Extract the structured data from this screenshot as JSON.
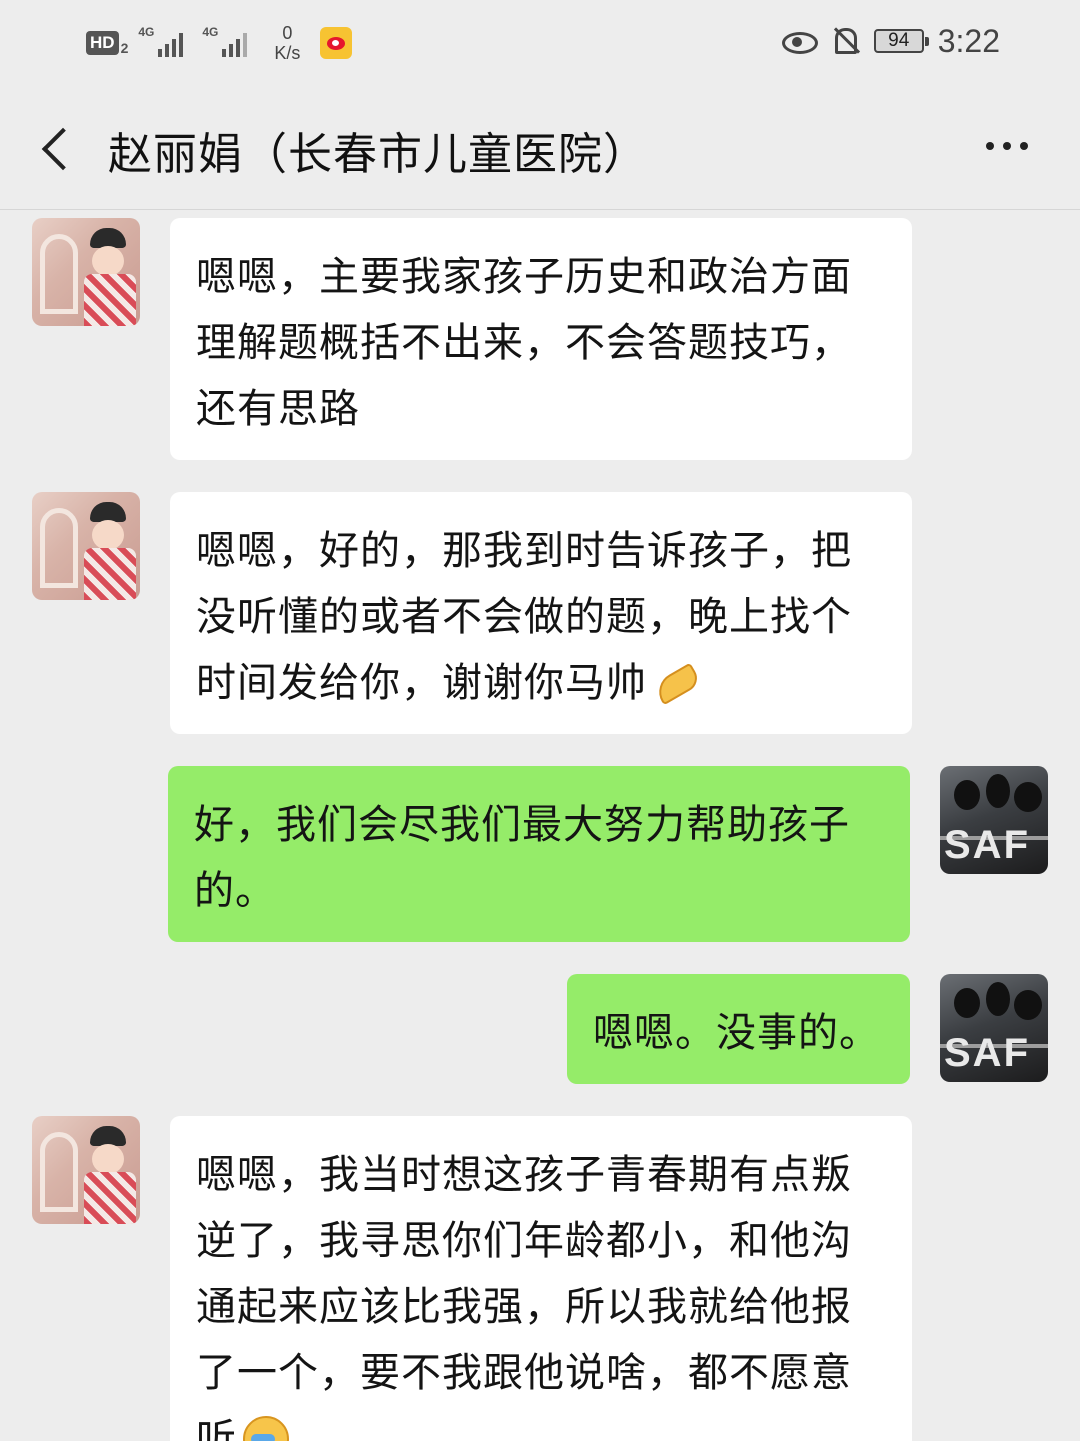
{
  "status_bar": {
    "hd": "HD",
    "hd_sub": "2",
    "sim1": "4G",
    "sim2": "4G",
    "speed_value": "0",
    "speed_unit": "K/s",
    "battery": "94",
    "time": "3:22"
  },
  "header": {
    "title": "赵丽娟（长春市儿童医院）"
  },
  "messages": [
    {
      "side": "in",
      "text": "嗯嗯，主要我家孩子历史和政治方面理解题概括不出来，不会答题技巧，还有思路"
    },
    {
      "side": "in",
      "text": "嗯嗯，好的，那我到时告诉孩子，把没听懂的或者不会做的题，晚上找个时间发给你，谢谢你马帅",
      "emoji": "praying-hands"
    },
    {
      "side": "out",
      "text": "好，我们会尽我们最大努力帮助孩子的。"
    },
    {
      "side": "out",
      "text": "嗯嗯。没事的。"
    },
    {
      "side": "in",
      "text": "嗯嗯，我当时想这孩子青春期有点叛逆了，我寻思你们年龄都小，和他沟通起来应该比我强，所以我就给他报了一个，要不我跟他说啥，都不愿意听",
      "emoji": "crying-face"
    }
  ],
  "avatar_text": "SAF",
  "colors": {
    "background": "#ededed",
    "incoming_bubble": "#ffffff",
    "outgoing_bubble": "#95ec69"
  }
}
